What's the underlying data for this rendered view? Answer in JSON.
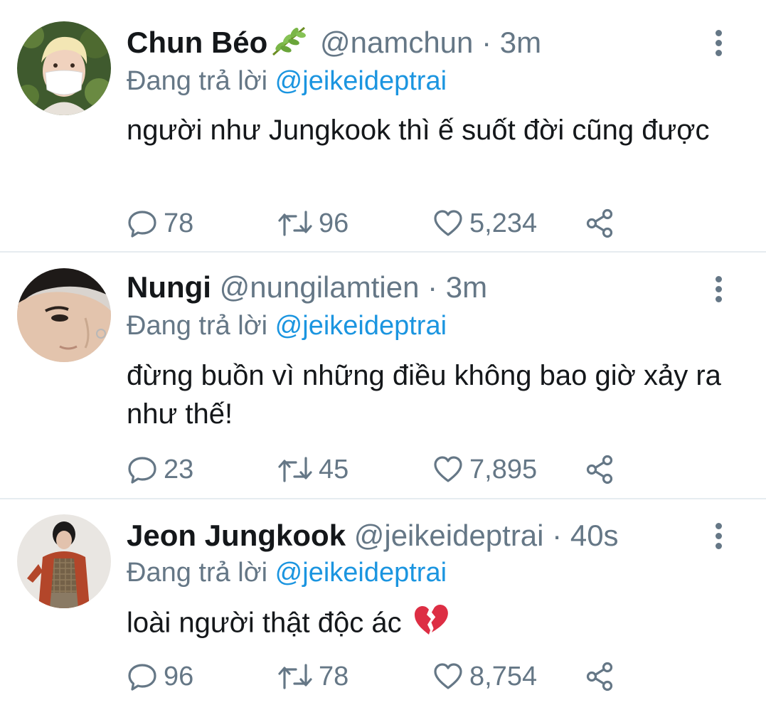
{
  "colors": {
    "text": "#14171a",
    "secondary": "#657786",
    "link": "#1b95e0",
    "divider": "#e6ecf0"
  },
  "tweets": [
    {
      "name": "Chun Béo",
      "name_emoji": "herb-emoji",
      "handle": "@namchun",
      "separator": "·",
      "time": "3m",
      "replying_prefix": "Đang trả lời",
      "replying_to": "@jeikeideptrai",
      "text": "người như Jungkook thì ế suốt đời cũng được",
      "text_emoji": "",
      "replies": "78",
      "retweets": "96",
      "likes": "5,234"
    },
    {
      "name": "Nungi",
      "name_emoji": "",
      "handle": "@nungilamtien",
      "separator": "·",
      "time": "3m",
      "replying_prefix": "Đang trả lời",
      "replying_to": "@jeikeideptrai",
      "text": "đừng buồn vì những điều không bao giờ xảy ra như thế!",
      "text_emoji": "",
      "replies": "23",
      "retweets": "45",
      "likes": "7,895"
    },
    {
      "name": "Jeon Jungkook",
      "name_emoji": "",
      "handle": "@jeikeideptrai",
      "separator": "·",
      "time": "40s",
      "replying_prefix": "Đang trả lời",
      "replying_to": "@jeikeideptrai",
      "text": "loài người thật độc ác",
      "text_emoji": "broken-heart-emoji",
      "replies": "96",
      "retweets": "78",
      "likes": "8,754"
    }
  ]
}
